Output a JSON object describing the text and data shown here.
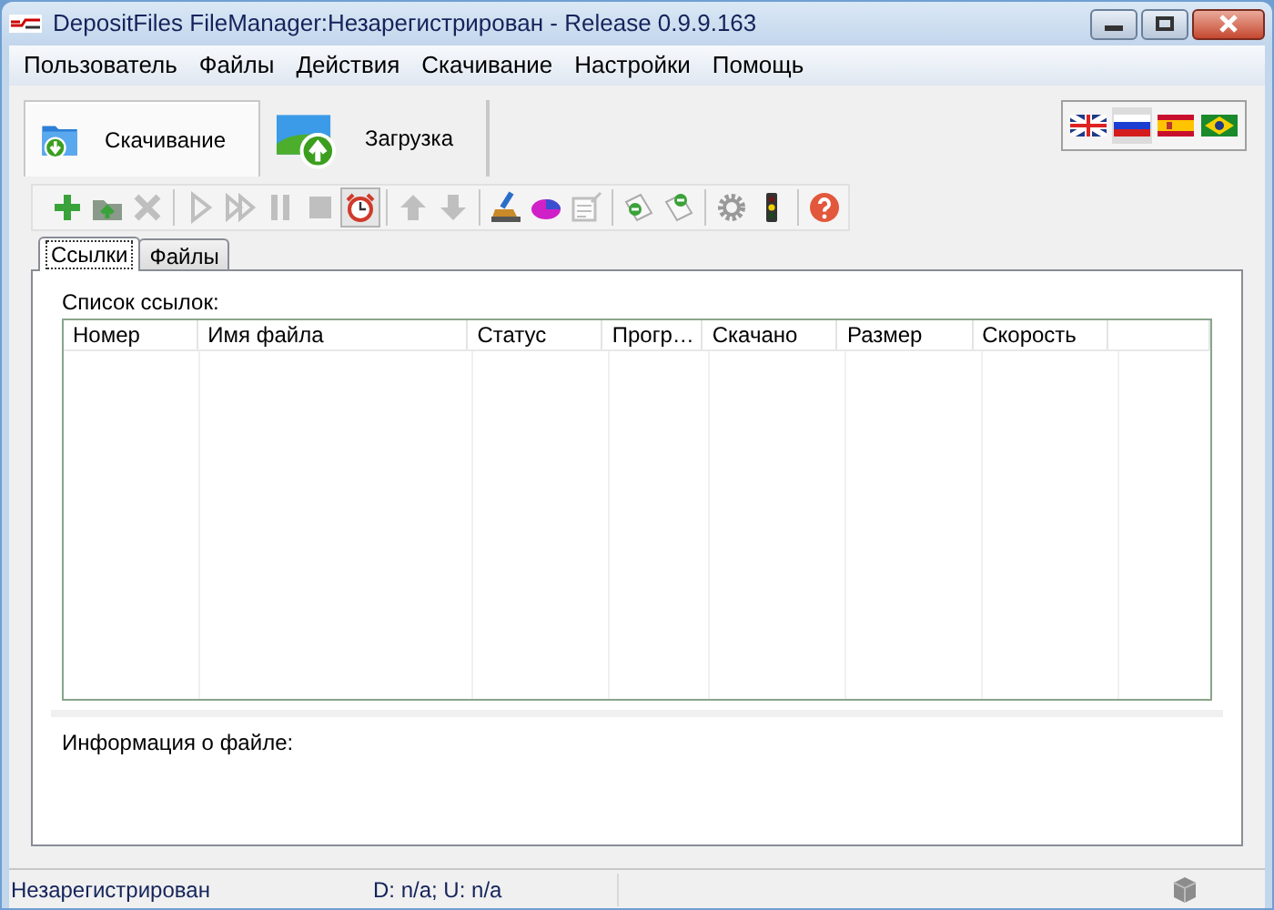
{
  "window": {
    "title": "DepositFiles FileManager:Незарегистрирован - Release 0.9.9.163"
  },
  "menu": [
    "Пользователь",
    "Файлы",
    "Действия",
    "Скачивание",
    "Настройки",
    "Помощь"
  ],
  "mode_tabs": [
    {
      "label": "Скачивание",
      "kind": "download",
      "selected": true
    },
    {
      "label": "Загрузка",
      "kind": "upload",
      "selected": false
    }
  ],
  "languages": [
    {
      "kind": "uk",
      "selected": false
    },
    {
      "kind": "ru",
      "selected": true
    },
    {
      "kind": "es",
      "selected": false
    },
    {
      "kind": "br",
      "selected": false
    }
  ],
  "toolbar": [
    {
      "kind": "add",
      "disabled": false,
      "pressed": false
    },
    {
      "kind": "add-folder",
      "disabled": false,
      "pressed": false
    },
    {
      "kind": "delete",
      "disabled": true,
      "pressed": false
    },
    {
      "kind": "separator"
    },
    {
      "kind": "play",
      "disabled": true,
      "pressed": false
    },
    {
      "kind": "play-all",
      "disabled": true,
      "pressed": false
    },
    {
      "kind": "pause",
      "disabled": true,
      "pressed": false
    },
    {
      "kind": "stop",
      "disabled": true,
      "pressed": false
    },
    {
      "kind": "clock",
      "disabled": false,
      "pressed": true
    },
    {
      "kind": "separator"
    },
    {
      "kind": "up",
      "disabled": true,
      "pressed": false
    },
    {
      "kind": "down",
      "disabled": true,
      "pressed": false
    },
    {
      "kind": "separator"
    },
    {
      "kind": "broom",
      "disabled": false,
      "pressed": false
    },
    {
      "kind": "pie",
      "disabled": false,
      "pressed": false
    },
    {
      "kind": "note",
      "disabled": true,
      "pressed": false
    },
    {
      "kind": "separator"
    },
    {
      "kind": "tag-import",
      "disabled": false,
      "pressed": false
    },
    {
      "kind": "tag-export",
      "disabled": false,
      "pressed": false
    },
    {
      "kind": "separator"
    },
    {
      "kind": "gear",
      "disabled": false,
      "pressed": false
    },
    {
      "kind": "traffic-light",
      "disabled": false,
      "pressed": false
    },
    {
      "kind": "separator"
    },
    {
      "kind": "help",
      "disabled": false,
      "pressed": false
    }
  ],
  "tabs": [
    {
      "label": "Ссылки",
      "selected": true
    },
    {
      "label": "Файлы",
      "selected": false
    }
  ],
  "links_label": "Список ссылок:",
  "table": {
    "columns": [
      "Номер",
      "Имя файла",
      "Статус",
      "Прогр…",
      "Скачано",
      "Размер",
      "Скорость"
    ]
  },
  "file_info_label": "Информация о файле:",
  "status_bar": {
    "user": "Незарегистрирован",
    "traffic": "D: n/a; U: n/a"
  }
}
